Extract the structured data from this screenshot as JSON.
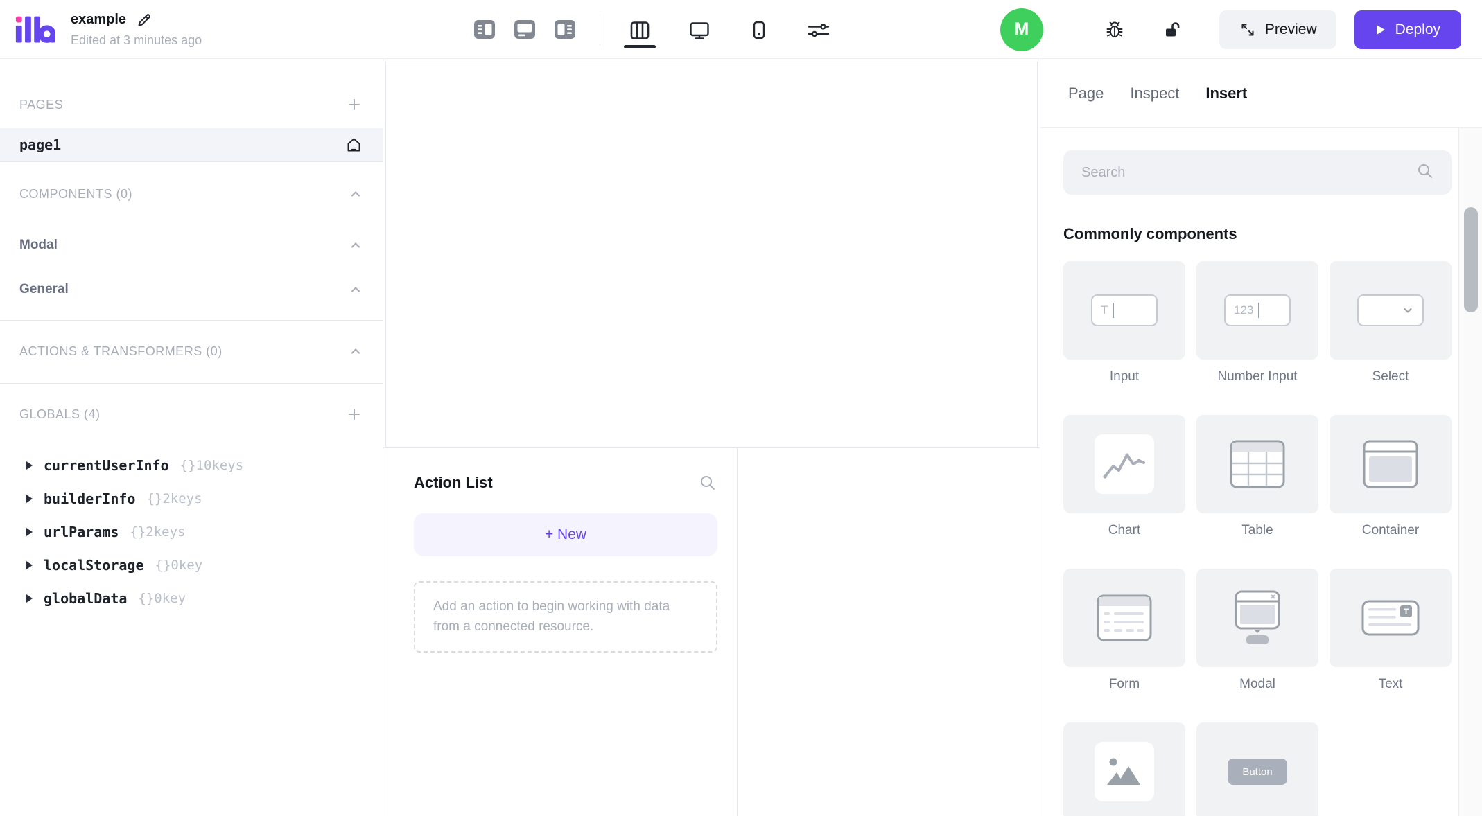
{
  "app": {
    "logo": "illa",
    "title": "example",
    "edited_text": "Edited at 3 minutes ago"
  },
  "topbar": {
    "avatar_initial": "M",
    "preview_label": "Preview",
    "deploy_label": "Deploy"
  },
  "sidebar": {
    "pages": {
      "header": "PAGES",
      "items": [
        {
          "name": "page1",
          "selected": true,
          "is_home": true
        }
      ]
    },
    "components": {
      "header": "COMPONENTS (0)",
      "groups": [
        {
          "label": "Modal"
        },
        {
          "label": "General"
        }
      ]
    },
    "actions": {
      "header": "ACTIONS & TRANSFORMERS (0)"
    },
    "globals": {
      "header": "GLOBALS (4)",
      "items": [
        {
          "name": "currentUserInfo",
          "meta": "{}10keys"
        },
        {
          "name": "builderInfo",
          "meta": "{}2keys"
        },
        {
          "name": "urlParams",
          "meta": "{}2keys"
        },
        {
          "name": "localStorage",
          "meta": "{}0key"
        },
        {
          "name": "globalData",
          "meta": "{}0key"
        }
      ]
    }
  },
  "action_panel": {
    "title": "Action List",
    "new_label": "+ New",
    "empty_hint": "Add an action to begin working with data from a connected resource."
  },
  "right_panel": {
    "tabs": [
      {
        "label": "Page",
        "active": false
      },
      {
        "label": "Inspect",
        "active": false
      },
      {
        "label": "Insert",
        "active": true
      }
    ],
    "search_placeholder": "Search",
    "section_title": "Commonly components",
    "icon_texts": {
      "input": "T",
      "number": "123",
      "button": "Button"
    },
    "components": [
      {
        "label": "Input",
        "icon": "input-icon"
      },
      {
        "label": "Number Input",
        "icon": "number-input-icon"
      },
      {
        "label": "Select",
        "icon": "select-icon"
      },
      {
        "label": "Chart",
        "icon": "chart-icon"
      },
      {
        "label": "Table",
        "icon": "table-icon"
      },
      {
        "label": "Container",
        "icon": "container-icon"
      },
      {
        "label": "Form",
        "icon": "form-icon"
      },
      {
        "label": "Modal",
        "icon": "modal-icon"
      },
      {
        "label": "Text",
        "icon": "text-icon"
      },
      {
        "icon": "image-icon"
      },
      {
        "icon": "button-icon"
      }
    ]
  },
  "colors": {
    "accent": "#6644ee",
    "avatar_green": "#3fcf5c",
    "logo_purple": "#6546ec",
    "logo_pink": "#ff3cab"
  }
}
